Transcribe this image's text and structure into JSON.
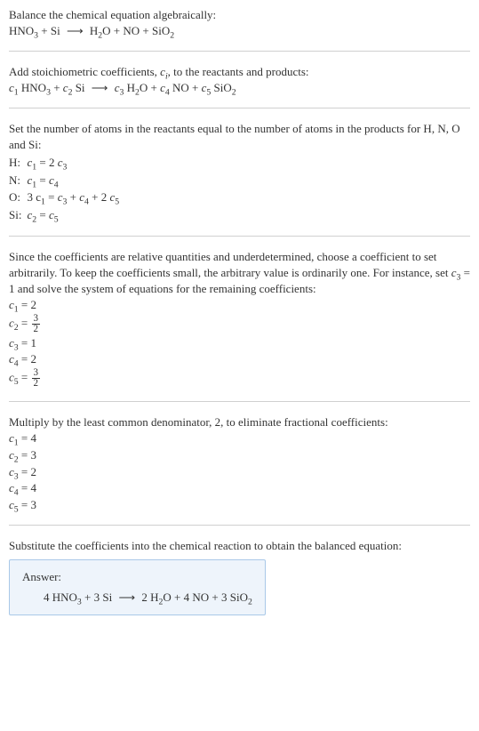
{
  "section1": {
    "title": "Balance the chemical equation algebraically:"
  },
  "section2": {
    "text": "Add stoichiometric coefficients, ",
    "ci": "c",
    "ci_sub": "i",
    "text2": ", to the reactants and products:"
  },
  "section3": {
    "text": "Set the number of atoms in the reactants equal to the number of atoms in the products for H, N, O and Si:",
    "rows": [
      {
        "el": "H:",
        "lhs": "c",
        "lhs_sub": "1",
        "eq": " = 2 ",
        "rhs": "c",
        "rhs_sub": "3"
      },
      {
        "el": "N:",
        "lhs": "c",
        "lhs_sub": "1",
        "eq": " = ",
        "rhs": "c",
        "rhs_sub": "4"
      },
      {
        "el": "O:",
        "lhs": "3 c",
        "lhs_sub": "1",
        "eq": " = ",
        "rhs": "c",
        "rhs_sub": "3",
        "plus": " + ",
        "t2": "c",
        "t2_sub": "4",
        "plus2": " + 2 ",
        "t3": "c",
        "t3_sub": "5"
      },
      {
        "el": "Si:",
        "lhs": "c",
        "lhs_sub": "2",
        "eq": " = ",
        "rhs": "c",
        "rhs_sub": "5"
      }
    ]
  },
  "section4": {
    "text": "Since the coefficients are relative quantities and underdetermined, choose a coefficient to set arbitrarily. To keep the coefficients small, the arbitrary value is ordinarily one. For instance, set ",
    "set_c": "c",
    "set_c_sub": "3",
    "set_val": " = 1 and solve the system of equations for the remaining coefficients:",
    "coefs": {
      "c1": {
        "label": "c",
        "sub": "1",
        "val": " = 2"
      },
      "c2": {
        "label": "c",
        "sub": "2",
        "eq": " = ",
        "num": "3",
        "den": "2"
      },
      "c3": {
        "label": "c",
        "sub": "3",
        "val": " = 1"
      },
      "c4": {
        "label": "c",
        "sub": "4",
        "val": " = 2"
      },
      "c5": {
        "label": "c",
        "sub": "5",
        "eq": " = ",
        "num": "3",
        "den": "2"
      }
    }
  },
  "section5": {
    "text": "Multiply by the least common denominator, 2, to eliminate fractional coefficients:",
    "coefs": {
      "c1": {
        "label": "c",
        "sub": "1",
        "val": " = 4"
      },
      "c2": {
        "label": "c",
        "sub": "2",
        "val": " = 3"
      },
      "c3": {
        "label": "c",
        "sub": "3",
        "val": " = 2"
      },
      "c4": {
        "label": "c",
        "sub": "4",
        "val": " = 4"
      },
      "c5": {
        "label": "c",
        "sub": "5",
        "val": " = 3"
      }
    }
  },
  "section6": {
    "text": "Substitute the coefficients into the chemical reaction to obtain the balanced equation:"
  },
  "answer": {
    "label": "Answer:"
  },
  "chem": {
    "HNO3": {
      "a": "HNO",
      "sub": "3"
    },
    "Si": "Si",
    "H2O": {
      "a": "H",
      "sub": "2",
      "b": "O"
    },
    "NO": "NO",
    "SiO2": {
      "a": "SiO",
      "sub": "2"
    },
    "plus": " + ",
    "arrow": "⟶",
    "c": "c",
    "sub1": "1",
    "sub2": "2",
    "sub3": "3",
    "sub4": "4",
    "sub5": "5",
    "four": "4 ",
    "three": "3 ",
    "two": "2 "
  }
}
